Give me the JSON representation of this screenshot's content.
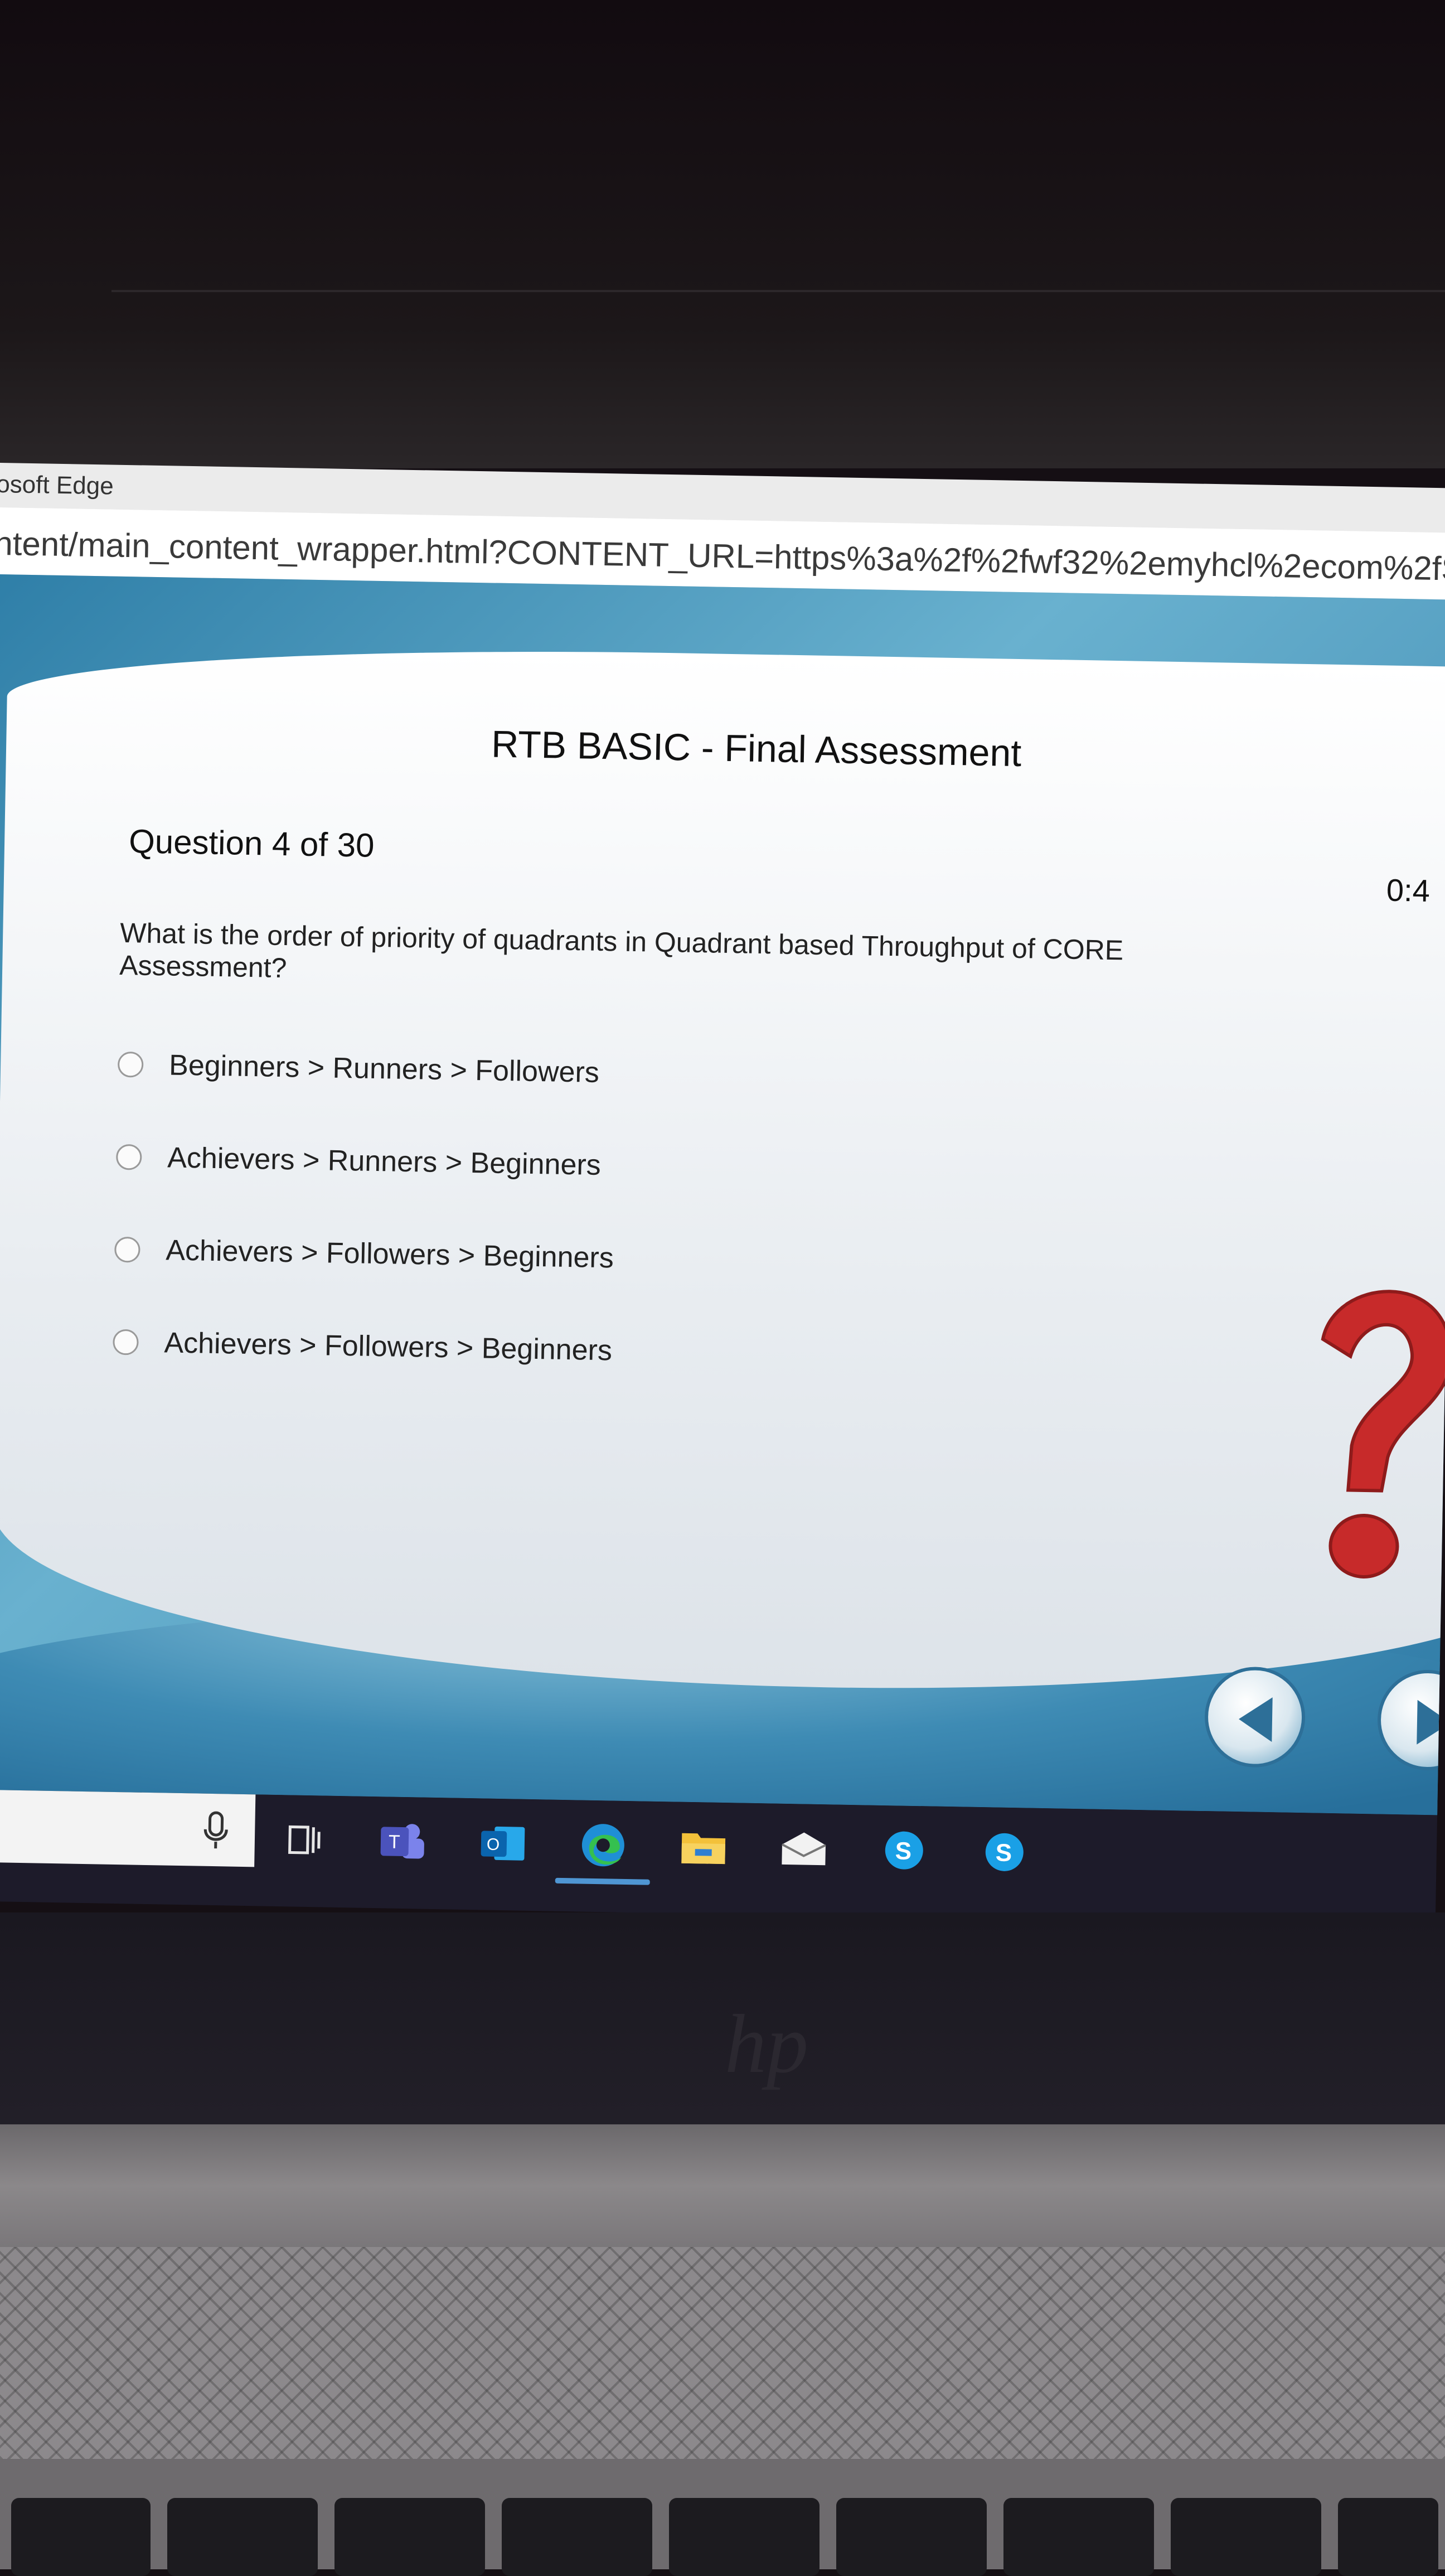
{
  "browser": {
    "title_fragment": "osoft Edge",
    "url_fragment": "ntent/main_content_wrapper.html?CONTENT_URL=https%3a%2f%2fwf32%2emyhcl%2ecom%2fSFC"
  },
  "assessment": {
    "title": "RTB BASIC - Final Assessment",
    "question_count": "Question 4 of 30",
    "timer": "0:4",
    "question": "What is the order of priority of quadrants in Quadrant based Throughput of CORE Assessment?",
    "options": [
      "Beginners > Runners > Followers",
      "Achievers > Runners > Beginners",
      "Achievers > Followers > Beginners",
      "Achievers > Followers > Beginners"
    ]
  },
  "taskbar": {
    "icons": [
      "microphone-icon",
      "task-view-icon",
      "teams-icon",
      "outlook-icon",
      "edge-icon",
      "file-explorer-icon",
      "mail-icon",
      "skype-icon",
      "skype-icon"
    ],
    "teams_letter": "T",
    "outlook_letter": "O",
    "skype_letter": "S"
  },
  "device": {
    "logo": "hp"
  },
  "colors": {
    "accent_blue": "#2f7fa8",
    "question_mark_red": "#c72a2a",
    "edge_active": "#4f96d3"
  }
}
